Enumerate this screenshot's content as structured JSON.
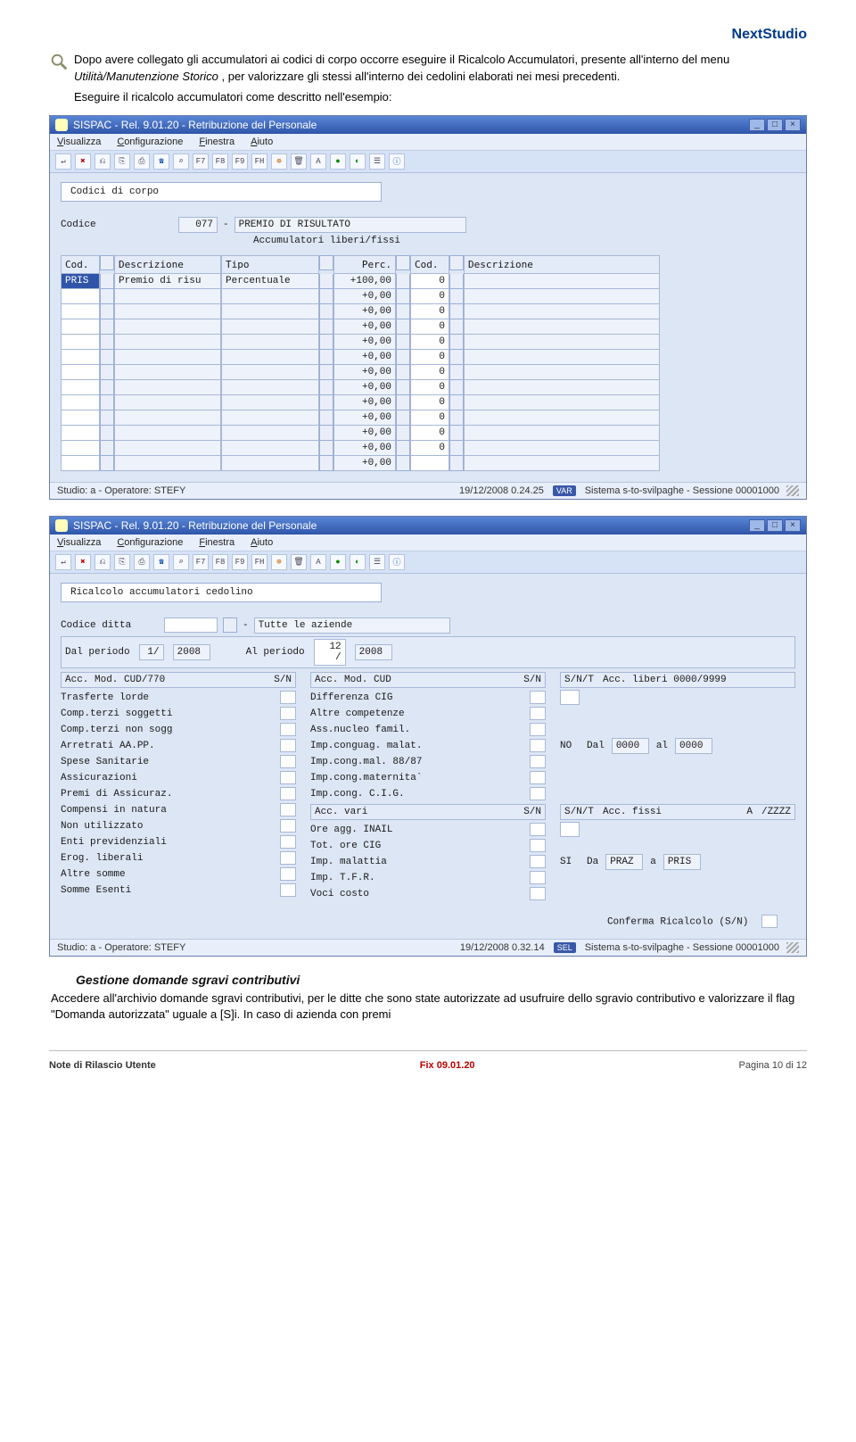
{
  "brand": "NextStudio",
  "intro": {
    "part1": "Dopo avere collegato gli accumulatori ai codici di corpo occorre eseguire il Ricalcolo Accumulatori, presente all'interno del menu ",
    "menu_path": "Utilità/Manutenzione Storico",
    "part2": ", per valorizzare gli stessi all'interno dei cedolini elaborati nei mesi precedenti.",
    "line2": "Eseguire il ricalcolo accumulatori come descritto nell'esempio:"
  },
  "win1": {
    "title": "SISPAC - Rel. 9.01.20 - Retribuzione del Personale",
    "menu": {
      "m1": "Visualizza",
      "m2": "Configurazione",
      "m3": "Finestra",
      "m4": "Aiuto"
    },
    "panel_title": "Codici di corpo",
    "codice_lbl": "Codice",
    "codice_val": "077",
    "dash": "-",
    "codice_desc": "PREMIO DI RISULTATO",
    "subhdr": "Accumulatori liberi/fissi",
    "cols": {
      "c1": "Cod.",
      "c2": "Descrizione",
      "c3": "Tipo",
      "c4": "Perc.",
      "c5": "Cod.",
      "c6": "Descrizione"
    },
    "rows": [
      {
        "cod": "PRIS",
        "desc": "Premio di risu",
        "tipo": "Percentuale",
        "perc": "+100,00",
        "c5": "0"
      },
      {
        "cod": "",
        "desc": "",
        "tipo": "",
        "perc": "+0,00",
        "c5": "0"
      },
      {
        "cod": "",
        "desc": "",
        "tipo": "",
        "perc": "+0,00",
        "c5": "0"
      },
      {
        "cod": "",
        "desc": "",
        "tipo": "",
        "perc": "+0,00",
        "c5": "0"
      },
      {
        "cod": "",
        "desc": "",
        "tipo": "",
        "perc": "+0,00",
        "c5": "0"
      },
      {
        "cod": "",
        "desc": "",
        "tipo": "",
        "perc": "+0,00",
        "c5": "0"
      },
      {
        "cod": "",
        "desc": "",
        "tipo": "",
        "perc": "+0,00",
        "c5": "0"
      },
      {
        "cod": "",
        "desc": "",
        "tipo": "",
        "perc": "+0,00",
        "c5": "0"
      },
      {
        "cod": "",
        "desc": "",
        "tipo": "",
        "perc": "+0,00",
        "c5": "0"
      },
      {
        "cod": "",
        "desc": "",
        "tipo": "",
        "perc": "+0,00",
        "c5": "0"
      },
      {
        "cod": "",
        "desc": "",
        "tipo": "",
        "perc": "+0,00",
        "c5": "0"
      },
      {
        "cod": "",
        "desc": "",
        "tipo": "",
        "perc": "+0,00",
        "c5": "0"
      },
      {
        "cod": "",
        "desc": "",
        "tipo": "",
        "perc": "+0,00",
        "c5": ""
      }
    ],
    "status": {
      "left": "Studio: a - Operatore: STEFY",
      "mid": "19/12/2008 0.24.25",
      "badge": "VAR",
      "right": "Sistema s-to-svilpaghe - Sessione 00001000"
    }
  },
  "win2": {
    "title": "SISPAC - Rel. 9.01.20 - Retribuzione del Personale",
    "menu": {
      "m1": "Visualizza",
      "m2": "Configurazione",
      "m3": "Finestra",
      "m4": "Aiuto"
    },
    "panel_title": "Ricalcolo accumulatori cedolino",
    "ditta_lbl": "Codice ditta",
    "ditta_desc": "Tutte le aziende",
    "dal_lbl": "Dal periodo",
    "dal_m": "1/",
    "dal_y": "2008",
    "al_lbl": "Al periodo",
    "al_m": "12 /",
    "al_y": "2008",
    "colA_hdr": "Acc. Mod. CUD/770",
    "snA": "S/N",
    "colB_hdr": "Acc. Mod.   CUD",
    "snB": "S/N",
    "colC_hdr1": "S/N/T",
    "colC_hdr2": "Acc. liberi 0000/9999",
    "colA": [
      "Trasferte lorde",
      "Comp.terzi soggetti",
      "Comp.terzi non sogg",
      "Arretrati AA.PP.",
      "Spese Sanitarie",
      "Assicurazioni",
      "Premi di Assicuraz.",
      "Compensi in natura",
      "Non utilizzato",
      "Enti previdenziali",
      "Erog. liberali",
      "Altre somme",
      "Somme Esenti"
    ],
    "colB": [
      "Differenza CIG",
      "Altre competenze",
      "Ass.nucleo famil.",
      "Imp.conguag. malat.",
      "Imp.cong.mal. 88/87",
      "Imp.cong.maternita`",
      "Imp.cong. C.I.G.",
      "  Acc. vari",
      "Ore agg. INAIL",
      "Tot. ore CIG",
      "Imp. malattia",
      "Imp. T.F.R.",
      "Voci costo"
    ],
    "colB_sn_at": 7,
    "colB_sn": "S/N",
    "colC": {
      "no_lbl": "NO",
      "dal": "Dal",
      "dal_v": "0000",
      "al": "al",
      "al_v": "0000",
      "snt": "S/N/T",
      "acc_fissi": "Acc. fissi",
      "A": "A",
      "Z": "/ZZZZ",
      "si": "SI",
      "da": "Da",
      "da_v": "PRAZ",
      "a": "a",
      "a_v": "PRIS"
    },
    "confirm": "Conferma Ricalcolo (S/N)",
    "status": {
      "left": "Studio: a - Operatore: STEFY",
      "mid": "19/12/2008 0.32.14",
      "badge": "SEL",
      "right": "Sistema s-to-svilpaghe - Sessione 00001000"
    }
  },
  "heading2": "Gestione domande sgravi contributivi",
  "bodytxt": "Accedere all'archivio domande sgravi contributivi, per le ditte che sono state autorizzate ad usufruire dello sgravio contributivo e valorizzare il flag \"Domanda autorizzata\" uguale a [S]i. In caso di azienda con premi",
  "footer": {
    "left": "Note di Rilascio Utente",
    "mid": "Fix  09.01.20",
    "right": "Pagina 10 di 12"
  }
}
